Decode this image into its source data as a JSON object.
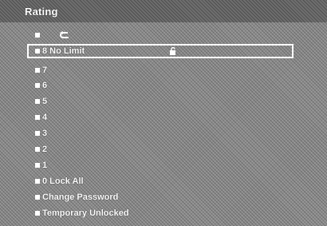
{
  "window": {
    "title": "Rating"
  },
  "menu": {
    "items": [
      {
        "label": "",
        "icon": "back-arrow-icon"
      },
      {
        "label": "8 No Limit",
        "icon": "lock-icon",
        "selected": true
      },
      {
        "label": "7"
      },
      {
        "label": "6"
      },
      {
        "label": "5"
      },
      {
        "label": "4"
      },
      {
        "label": "3"
      },
      {
        "label": "2"
      },
      {
        "label": "1"
      },
      {
        "label": "0 Lock All"
      },
      {
        "label": "Change Password"
      },
      {
        "label": "Temporary Unlocked"
      }
    ]
  },
  "colors": {
    "background": "#8c8c8c",
    "title_bar": "#6e6e6e",
    "text": "#ffffff",
    "selection_border": "#ffffff"
  }
}
